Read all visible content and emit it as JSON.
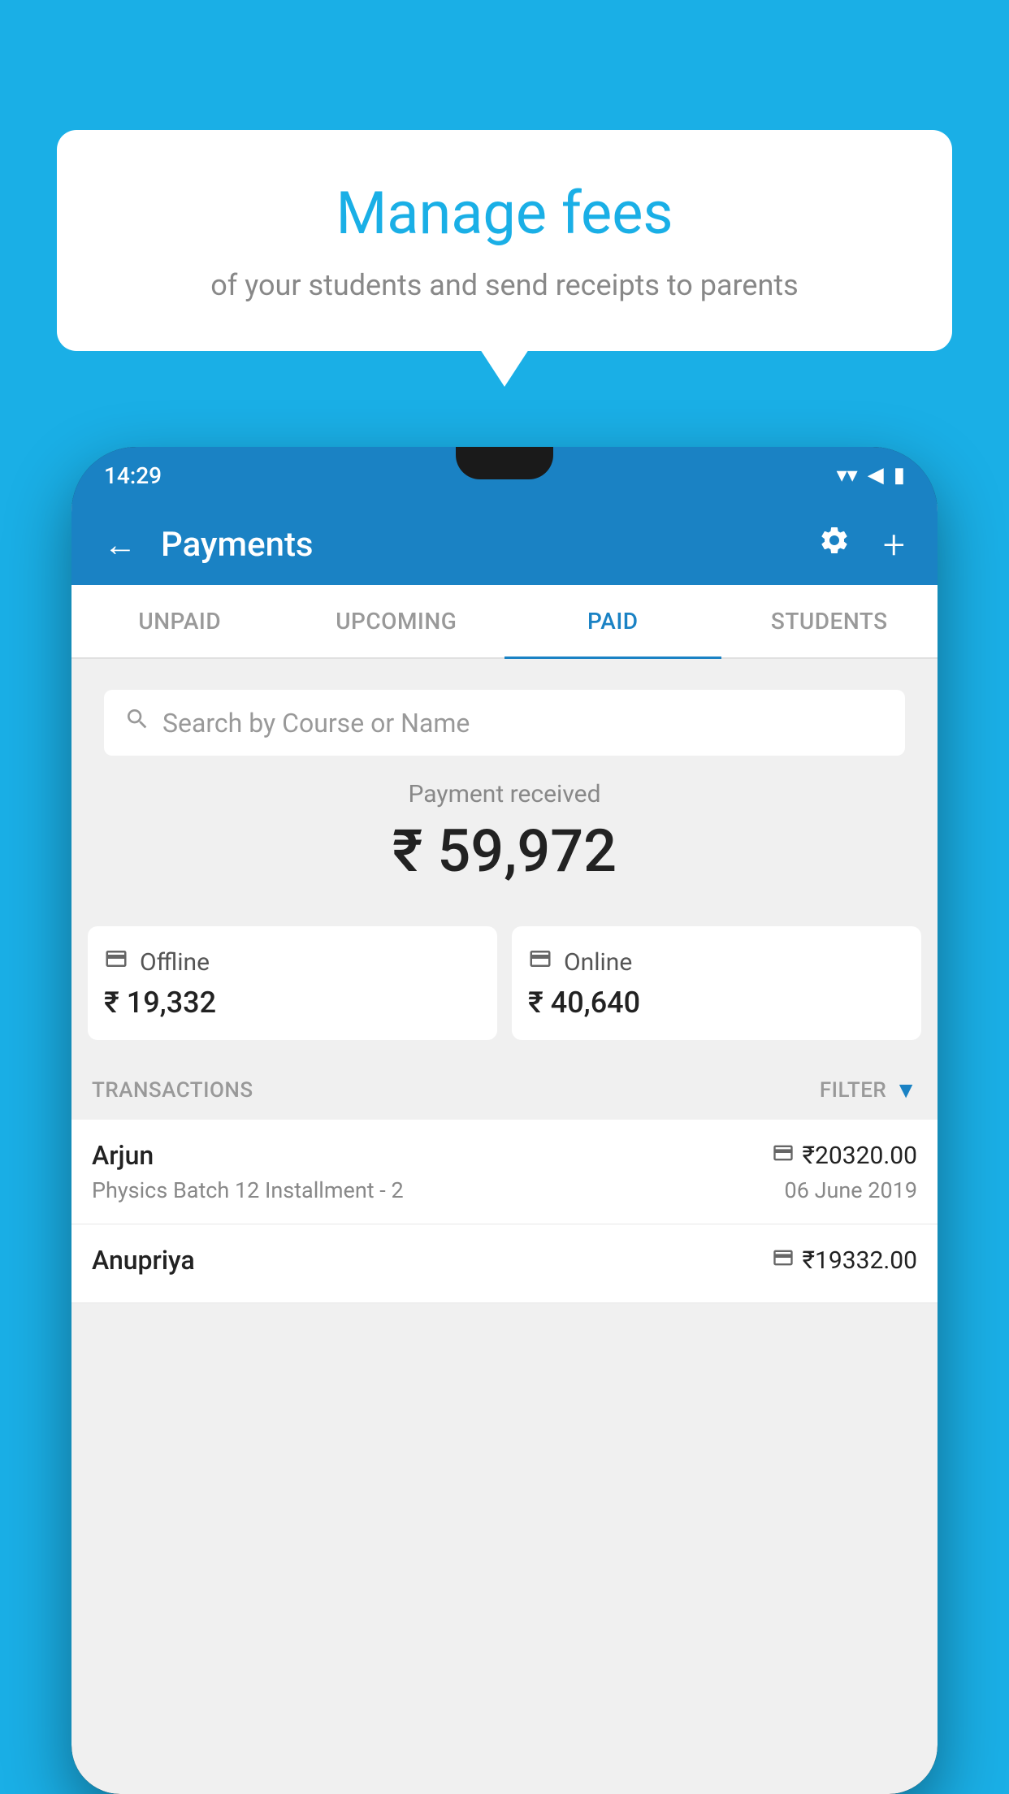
{
  "background_color": "#1AAFE6",
  "speech_bubble": {
    "title": "Manage fees",
    "subtitle": "of your students and send receipts to parents"
  },
  "status_bar": {
    "time": "14:29",
    "wifi_icon": "▼",
    "signal_icon": "◀",
    "battery_icon": "▮"
  },
  "header": {
    "title": "Payments",
    "back_label": "←",
    "plus_label": "+",
    "gear_label": "⚙"
  },
  "tabs": [
    {
      "label": "UNPAID",
      "active": false
    },
    {
      "label": "UPCOMING",
      "active": false
    },
    {
      "label": "PAID",
      "active": true
    },
    {
      "label": "STUDENTS",
      "active": false
    }
  ],
  "search": {
    "placeholder": "Search by Course or Name"
  },
  "payment_summary": {
    "label": "Payment received",
    "amount": "₹ 59,972",
    "offline_label": "Offline",
    "offline_amount": "₹ 19,332",
    "online_label": "Online",
    "online_amount": "₹ 40,640"
  },
  "transactions_section": {
    "label": "TRANSACTIONS",
    "filter_label": "FILTER"
  },
  "transactions": [
    {
      "name": "Arjun",
      "amount": "₹20320.00",
      "amount_type": "online",
      "course": "Physics Batch 12 Installment - 2",
      "date": "06 June 2019"
    },
    {
      "name": "Anupriya",
      "amount": "₹19332.00",
      "amount_type": "offline",
      "course": "",
      "date": ""
    }
  ]
}
